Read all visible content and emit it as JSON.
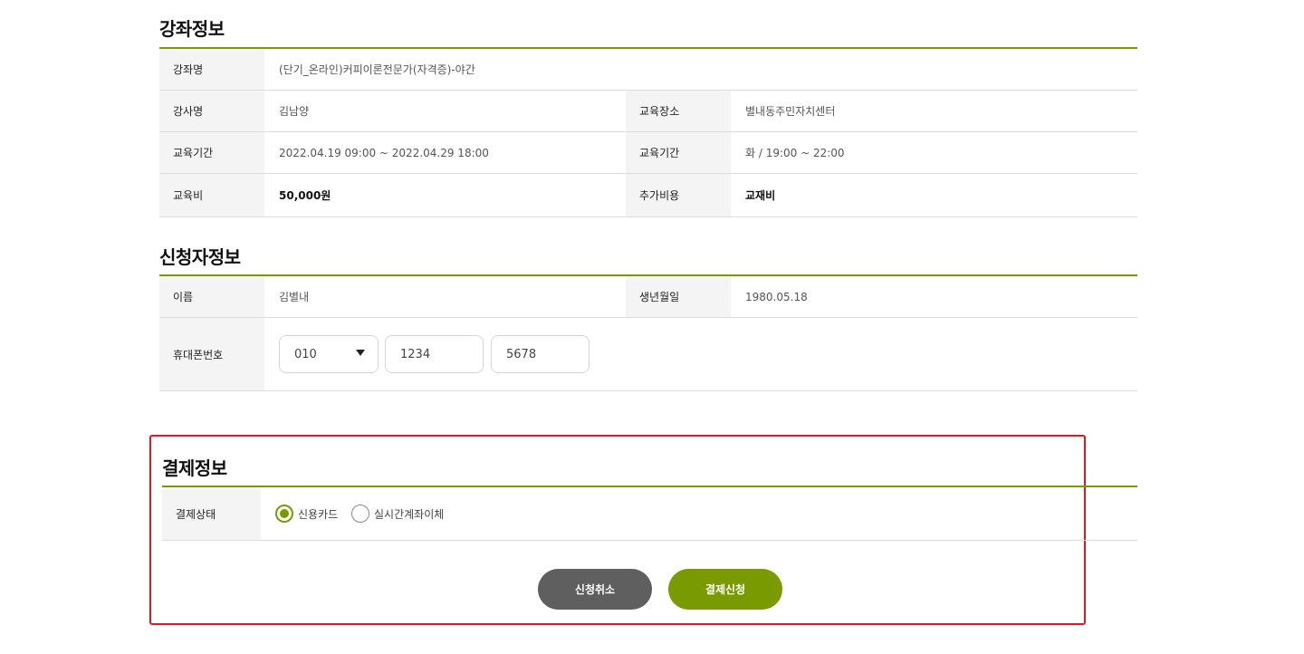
{
  "course_section": {
    "title": "강좌정보",
    "course_name_label": "강좌명",
    "course_name": "(단기_온라인)커피이론전문가(자격증)-야간",
    "instructor_label": "강사명",
    "instructor": "김남양",
    "location_label": "교육장소",
    "location": "별내동주민자치센터",
    "period_label": "교육기간",
    "period": "2022.04.19 09:00 ~ 2022.04.29 18:00",
    "schedule_label": "교육기간",
    "schedule": "화 / 19:00 ~ 22:00",
    "fee_label": "교육비",
    "fee": "50,000원",
    "extra_cost_label": "추가비용",
    "extra_cost": "교재비"
  },
  "applicant_section": {
    "title": "신청자정보",
    "name_label": "이름",
    "name": "김별내",
    "birth_label": "생년월일",
    "birth": "1980.05.18",
    "phone_label": "휴대폰번호",
    "phone_prefix": "010",
    "phone_middle": "1234",
    "phone_last": "5678"
  },
  "payment_section": {
    "title": "결제정보",
    "status_label": "결제상태",
    "option_card": "신용카드",
    "option_transfer": "실시간계좌이체",
    "selected": "신용카드"
  },
  "buttons": {
    "cancel": "신청취소",
    "submit": "결제신청"
  },
  "colors": {
    "accent": "#7a9a01",
    "cancel_button": "#5f5f5f",
    "highlight_border": "#e8141b"
  }
}
